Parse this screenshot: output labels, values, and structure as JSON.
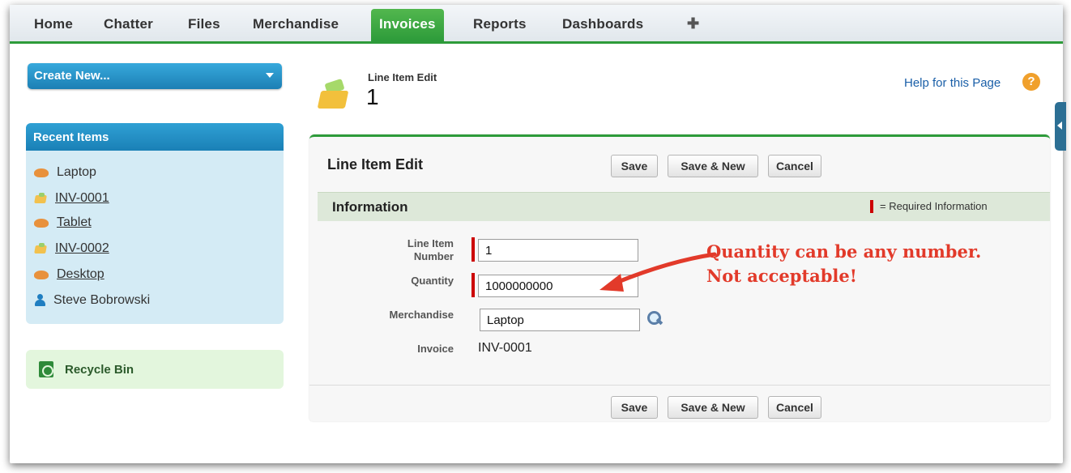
{
  "tabs": [
    {
      "label": "Home"
    },
    {
      "label": "Chatter"
    },
    {
      "label": "Files"
    },
    {
      "label": "Merchandise"
    },
    {
      "label": "Invoices",
      "active": true
    },
    {
      "label": "Reports"
    },
    {
      "label": "Dashboards"
    },
    {
      "label": "✚"
    }
  ],
  "sidebar": {
    "create_new": "Create New...",
    "recent_header": "Recent Items",
    "recent_items": [
      {
        "label": "Laptop",
        "icon": "merchandise-icon"
      },
      {
        "label": "INV-0001",
        "icon": "invoice-icon"
      },
      {
        "label": "Tablet",
        "icon": "merchandise-icon"
      },
      {
        "label": "INV-0002",
        "icon": "invoice-icon"
      },
      {
        "label": "Desktop",
        "icon": "merchandise-icon"
      },
      {
        "label": "Steve Bobrowski",
        "icon": "user-icon"
      }
    ],
    "recycle_bin": "Recycle Bin"
  },
  "header": {
    "subtitle": "Line Item Edit",
    "title": "1",
    "help": "Help for this Page",
    "help_icon": "?"
  },
  "panel": {
    "title": "Line Item Edit",
    "save": "Save",
    "save_new": "Save & New",
    "cancel": "Cancel",
    "section": "Information",
    "required_legend": "= Required Information",
    "fields": {
      "line_item_number": {
        "label1": "Line Item",
        "label2": "Number",
        "value": "1"
      },
      "quantity": {
        "label": "Quantity",
        "value": "1000000000"
      },
      "merchandise": {
        "label": "Merchandise",
        "value": "Laptop"
      },
      "invoice": {
        "label": "Invoice",
        "value": "INV-0001"
      }
    }
  },
  "annotation": {
    "line1": "Quantity can be any number.",
    "line2": "Not acceptable!"
  },
  "colors": {
    "accent_green": "#2d9b3a",
    "sidebar_blue": "#1c7fb4",
    "annotation_red": "#e23a2a",
    "required_red": "#cc0000"
  }
}
